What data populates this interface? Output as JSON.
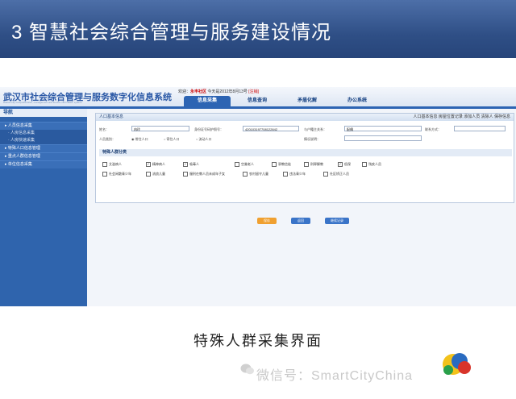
{
  "slide": {
    "title": "3  智慧社会综合管理与服务建设情况",
    "caption": "特殊人群采集界面",
    "watermark": "微信号：SmartCityChina"
  },
  "app": {
    "system_title": "武汉市社会综合管理与服务数字化信息系统",
    "system_subtitle": "Wuhan city comprehensive, management and service information system",
    "welcome_prefix": "欢迎：",
    "org": "永丰社区",
    "date": "今天是2012年8月13号",
    "logout": "[注销]",
    "nav_tabs": [
      "信息采集",
      "信息查询",
      "矛盾化解",
      "办公系统"
    ],
    "active_tab": "信息采集"
  },
  "sidebar": {
    "header": "导航",
    "items": [
      {
        "label": "▸ 人员信息采集",
        "type": "group"
      },
      {
        "label": "· 人房信息采集",
        "type": "sub"
      },
      {
        "label": "· 人房快速采集",
        "type": "sub"
      },
      {
        "label": "▸ 特殊人口信息管理",
        "type": "group"
      },
      {
        "label": "▸ 重点人群信息管理",
        "type": "group"
      },
      {
        "label": "▸ 单位信息采集",
        "type": "group"
      }
    ]
  },
  "panel": {
    "title": "人口基本信息",
    "links": "人口基本信息  房屋位置记录  添加人员  清除人  保存信息",
    "fields": {
      "name_label": "姓名：",
      "name_value": "冉玲",
      "id_label": "身份证号码护照号：",
      "id_value": "420103197708122842",
      "relation_label": "与户籍主关系：",
      "relation_value": "配偶",
      "contact_label": "联系方式：",
      "category_label": "人员类别：",
      "category_options": [
        "常住人口",
        "寄住人口",
        "流动人口"
      ],
      "category_selected": "常住人口",
      "note_label": "情况说明："
    },
    "section_title": "特殊人群分类",
    "checkboxes": [
      {
        "label": "艾滋病人",
        "checked": false
      },
      {
        "label": "精神病人",
        "checked": true
      },
      {
        "label": "吸毒人",
        "checked": true
      },
      {
        "label": "空巢老人",
        "checked": false
      },
      {
        "label": "邪教信徒",
        "checked": false
      },
      {
        "label": "刑释解教",
        "checked": false
      },
      {
        "label": "低保",
        "checked": true
      },
      {
        "label": "残疾人员",
        "checked": false
      },
      {
        "label": "社会闲散青少年",
        "checked": false
      },
      {
        "label": "流浪儿童",
        "checked": false
      },
      {
        "label": "服刑在教人员未成年子女",
        "checked": false
      },
      {
        "label": "农村留守儿童",
        "checked": false
      },
      {
        "label": "违法青少年",
        "checked": false
      },
      {
        "label": "社区矫正人员",
        "checked": false
      }
    ],
    "buttons": [
      {
        "label": "保存",
        "color": "#f0a030"
      },
      {
        "label": "返回",
        "color": "#3a74c8"
      },
      {
        "label": "继续记录",
        "color": "#3a74c8"
      }
    ]
  },
  "colors": {
    "title_bar": "#2f4f86",
    "sidebar": "#2f64ad",
    "accent": "#2d64b3"
  }
}
